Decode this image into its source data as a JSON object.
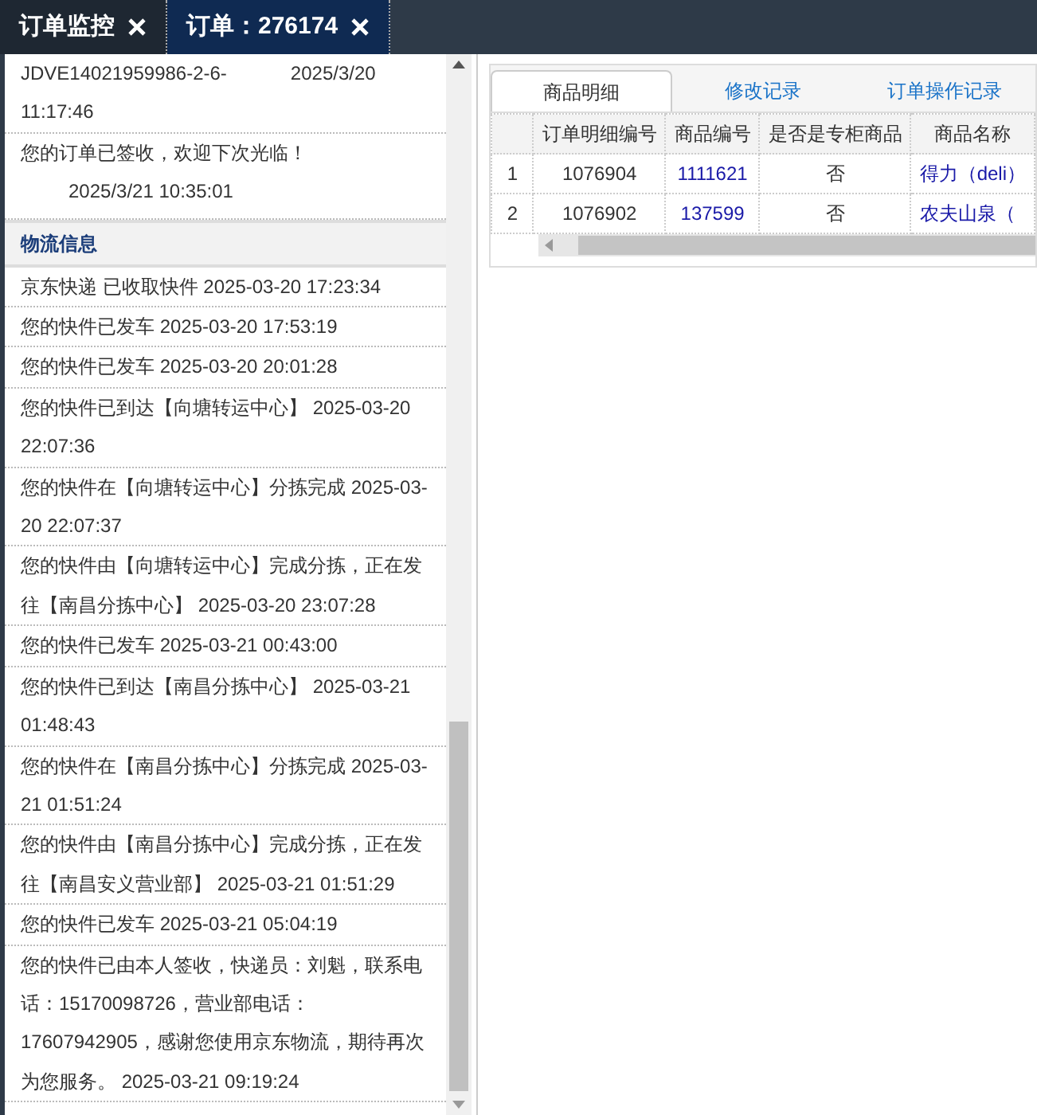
{
  "top_tabs": [
    {
      "label": "订单监控",
      "selected": false,
      "closable": true
    },
    {
      "label": "订单：276174",
      "selected": true,
      "closable": true
    }
  ],
  "order_log": [
    {
      "code": "JDVE14021959986-2-6-",
      "time": "2025/3/20 11:17:46"
    },
    {
      "message": "您的订单已签收，欢迎下次光临！",
      "time": "2025/3/21 10:35:01"
    }
  ],
  "logistics": {
    "title": "物流信息",
    "entries": [
      "京东快递 已收取快件 2025-03-20 17:23:34",
      "您的快件已发车 2025-03-20 17:53:19",
      "您的快件已发车 2025-03-20 20:01:28",
      "您的快件已到达【向塘转运中心】 2025-03-20 22:07:36",
      "您的快件在【向塘转运中心】分拣完成 2025-03-20 22:07:37",
      "您的快件由【向塘转运中心】完成分拣，正在发往【南昌分拣中心】 2025-03-20 23:07:28",
      "您的快件已发车 2025-03-21 00:43:00",
      "您的快件已到达【南昌分拣中心】 2025-03-21 01:48:43",
      "您的快件在【南昌分拣中心】分拣完成 2025-03-21 01:51:24",
      "您的快件由【南昌分拣中心】完成分拣，正在发往【南昌安义营业部】 2025-03-21 01:51:29",
      "您的快件已发车 2025-03-21 05:04:19",
      "您的快件已由本人签收，快递员：刘魁，联系电话：15170098726，营业部电话：17607942905，感谢您使用京东物流，期待再次为您服务。 2025-03-21 09:19:24"
    ]
  },
  "detail_tabs": [
    {
      "label": "商品明细",
      "selected": true
    },
    {
      "label": "修改记录",
      "selected": false
    },
    {
      "label": "订单操作记录",
      "selected": false
    }
  ],
  "table": {
    "columns": [
      "订单明细编号",
      "商品编号",
      "是否是专柜商品",
      "商品名称"
    ],
    "rows": [
      {
        "index": "1",
        "detail_id": "1076904",
        "product_code": "1111621",
        "counter": "否",
        "product_name": "得力（deli）"
      },
      {
        "index": "2",
        "detail_id": "1076902",
        "product_code": "137599",
        "counter": "否",
        "product_name": "农夫山泉（"
      }
    ]
  }
}
